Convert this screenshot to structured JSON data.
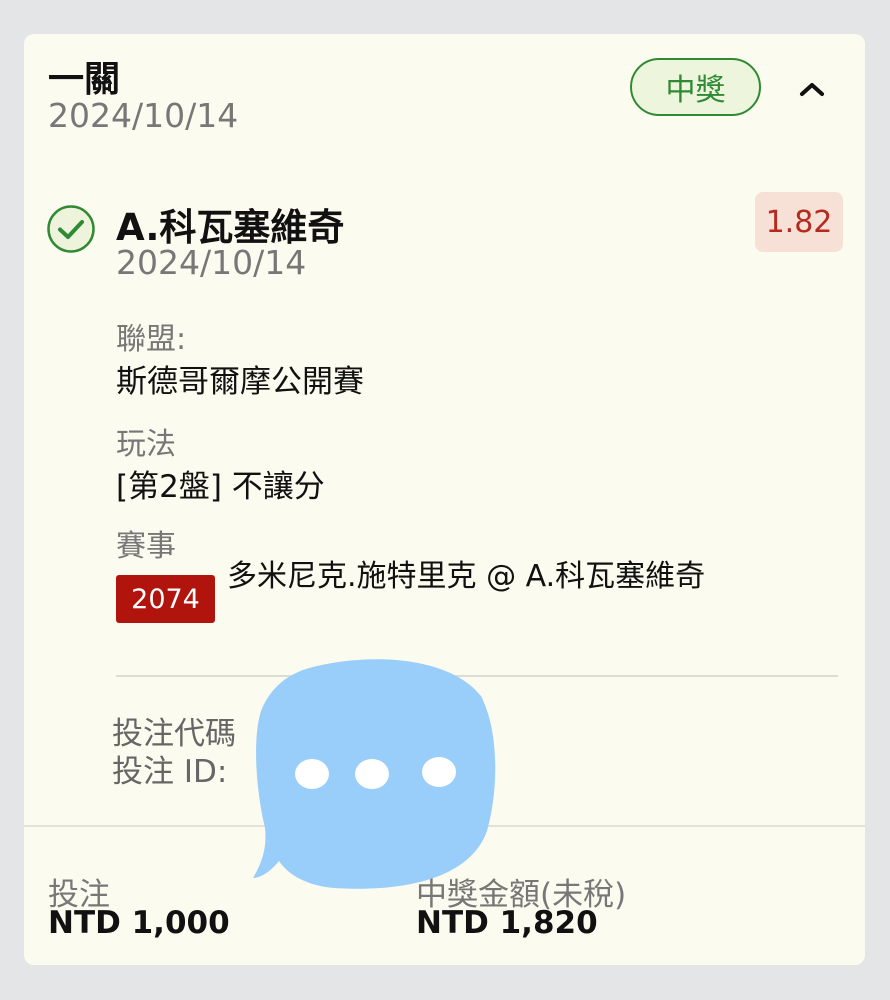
{
  "bet": {
    "type": "一關",
    "date": "2024/10/14",
    "status": "中獎"
  },
  "selection": {
    "name": "A.科瓦塞維奇",
    "date": "2024/10/14",
    "odds": "1.82"
  },
  "details": {
    "league_label": "聯盟:",
    "league_value": "斯德哥爾摩公開賽",
    "market_label": "玩法",
    "market_value": "[第2盤] 不讓分",
    "event_label": "賽事",
    "event_code": "2074",
    "event_name": "多米尼克.施特里克 @ A.科瓦塞維奇"
  },
  "ids": {
    "code_label": "投注代碼",
    "id_label": "投注 ID:"
  },
  "summary": {
    "stake_label": "投注",
    "stake_value": "NTD 1,000",
    "payout_label": "中獎金額(未稅)",
    "payout_value": "NTD 1,820"
  },
  "colors": {
    "win_green": "#2f8a33",
    "odds_red": "#b52a1f",
    "code_red": "#b1140d",
    "card_bg": "#fcfbf0",
    "overlay_blue": "#99cdfa"
  },
  "icons": {
    "status_check": "check-circle-icon",
    "collapse": "chevron-up-icon",
    "overlay": "chat-bubble-icon"
  }
}
